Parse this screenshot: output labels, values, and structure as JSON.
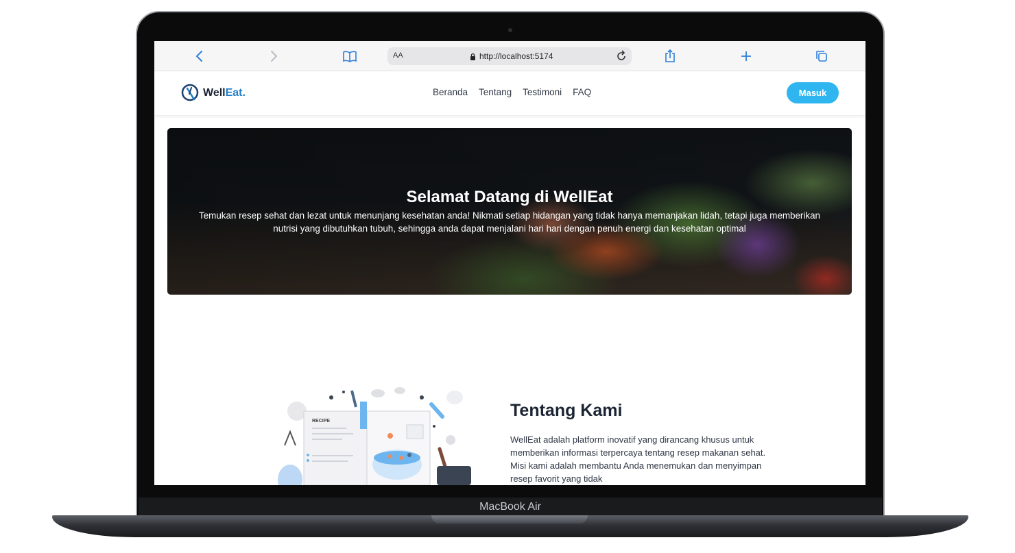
{
  "device": {
    "label": "MacBook Air"
  },
  "browser": {
    "text_size_label": "AA",
    "url": "http://localhost:5174"
  },
  "site": {
    "logo": {
      "text_main": "Well",
      "text_accent": "Eat."
    },
    "nav": [
      {
        "label": "Beranda"
      },
      {
        "label": "Tentang"
      },
      {
        "label": "Testimoni"
      },
      {
        "label": "FAQ"
      }
    ],
    "login_label": "Masuk",
    "colors": {
      "accent": "#2fb6f0",
      "brand": "#1f7fc9",
      "text": "#1b2433"
    }
  },
  "hero": {
    "title": "Selamat Datang di WellEat",
    "subtitle": "Temukan resep sehat dan lezat untuk menunjang kesehatan anda! Nikmati setiap hidangan yang tidak hanya memanjakan lidah, tetapi juga memberikan nutrisi yang dibutuhkan tubuh, sehingga anda dapat menjalani hari hari dengan penuh energi dan kesehatan optimal"
  },
  "about": {
    "illustration_label": "RECIPE",
    "title": "Tentang Kami",
    "text": "WellEat adalah platform inovatif yang dirancang khusus untuk memberikan informasi terpercaya tentang resep makanan sehat. Misi kami adalah membantu Anda menemukan dan menyimpan resep favorit yang tidak"
  }
}
